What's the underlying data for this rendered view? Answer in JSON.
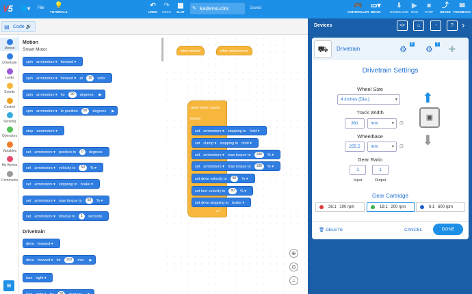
{
  "topbar": {
    "logo": "VEX",
    "file": "File",
    "tutorials": "TUTORIALS",
    "undo": "UNDO",
    "redo": "REDO",
    "slot": "SLOT",
    "project_name": "kadensucks",
    "saved": "Saved",
    "controller": "CONTROLLER",
    "brain": "BRAIN",
    "download": "DOWNLOAD",
    "run": "RUN",
    "stop": "STOP",
    "share": "SHARE",
    "feedback": "FEEDBACK"
  },
  "codebar": {
    "tab": "Code"
  },
  "categories": [
    "Motion",
    "Drivetrain",
    "Looks",
    "Events",
    "Control",
    "Sensing",
    "Operators",
    "Variables",
    "My Blocks",
    "Comments"
  ],
  "category_colors": [
    "#2f7de1",
    "#2f7de1",
    "#9b59d6",
    "#f6b73c",
    "#f0a020",
    "#38aadf",
    "#56c25a",
    "#f27a2a",
    "#e84b6b",
    "#999999"
  ],
  "palette": {
    "motion_title": "Motion",
    "motion_sub": "Smart Motor",
    "drivetrain_title": "Drivetrain",
    "blocks": [
      {
        "t": [
          "spin",
          "armmotors",
          "forward"
        ]
      },
      {
        "t": [
          "spin",
          "armmotors",
          "forward",
          "at",
          "10",
          "volts"
        ]
      },
      {
        "t": [
          "spin",
          "armmotors",
          "for",
          "90",
          "degrees"
        ]
      },
      {
        "t": [
          "spin",
          "armmotors",
          "to position",
          "90",
          "degrees"
        ]
      },
      {
        "t": [
          "stop",
          "armmotors"
        ]
      },
      {
        "t": [
          "set",
          "armmotors",
          "position to",
          "0",
          "degrees"
        ]
      },
      {
        "t": [
          "set",
          "armmotors",
          "velocity to",
          "50",
          "%"
        ]
      },
      {
        "t": [
          "set",
          "armmotors",
          "stopping to",
          "brake"
        ]
      },
      {
        "t": [
          "set",
          "armmotors",
          "max torque to",
          "50",
          "%"
        ]
      },
      {
        "t": [
          "set",
          "armmotors",
          "timeout to",
          "1",
          "seconds"
        ]
      },
      {
        "t": [
          "drive",
          "forward"
        ]
      },
      {
        "t": [
          "drive",
          "forward",
          "for",
          "200",
          "mm"
        ]
      },
      {
        "t": [
          "turn",
          "right"
        ]
      },
      {
        "t": [
          "turn",
          "right",
          "for",
          "90",
          "degrees"
        ]
      }
    ]
  },
  "workspace": {
    "hat1": "when started",
    "hat2": "when autonomous",
    "hat3": "when driver control",
    "forever": "forever",
    "stack": [
      [
        "set",
        "armmotors",
        "stopping to",
        "hold"
      ],
      [
        "set",
        "clamp",
        "stopping to",
        "hold"
      ],
      [
        "set",
        "armmotors",
        "max torque to",
        "100",
        "%"
      ],
      [
        "set",
        "armmotors",
        "max torque to",
        "100",
        "%"
      ],
      [
        "set drive velocity to",
        "80",
        "%"
      ],
      [
        "set turn velocity to",
        "80",
        "%"
      ],
      [
        "set drive stopping to",
        "brake"
      ]
    ]
  },
  "panel": {
    "title": "Devices",
    "device_name": "Drivetrain",
    "badge1": "6",
    "badge2": "7",
    "settings_title": "Drivetrain Settings",
    "wheel_size_label": "Wheel Size",
    "wheel_size": "4 inches (Dia.)",
    "track_width_label": "Track Width",
    "track_width": "381",
    "track_unit": "mm",
    "wheelbase_label": "Wheelbase",
    "wheelbase": "255.5",
    "wheelbase_unit": "mm",
    "gear_ratio_label": "Gear Ratio",
    "gear_input": "1",
    "gear_output": "1",
    "input_label": "Input",
    "output_label": "Output",
    "cartridge_label": "Gear Cartridge",
    "cartridges": [
      {
        "ratio": "36:1",
        "rpm": "100 rpm",
        "color": "#e23b3b"
      },
      {
        "ratio": "18:1",
        "rpm": "200 rpm",
        "color": "#3bb34a"
      },
      {
        "ratio": "6:1",
        "rpm": "600 rpm",
        "color": "#2060c8"
      }
    ],
    "delete": "DELETE",
    "cancel": "CANCEL",
    "done": "DONE"
  }
}
